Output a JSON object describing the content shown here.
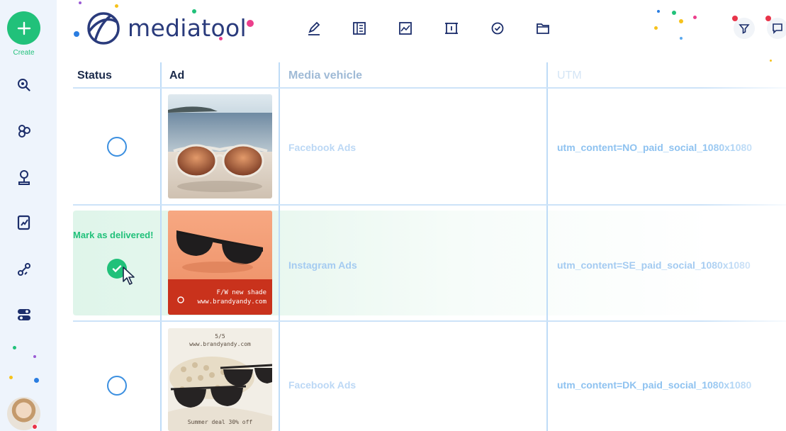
{
  "sidebar": {
    "create_label": "Create",
    "icons": [
      "search-icon",
      "hub-icon",
      "location-pin-icon",
      "report-icon",
      "link-icon",
      "toggle-icon"
    ]
  },
  "header": {
    "logo_text": "mediatool",
    "toolbar_icons": [
      "pen-icon",
      "form-icon",
      "chart-icon",
      "frame-icon",
      "check-badge-icon",
      "folder-icon"
    ],
    "right_buttons": [
      "filter-icon",
      "comment-icon"
    ]
  },
  "table": {
    "columns": [
      "Status",
      "Ad",
      "Media vehicle",
      "UTM"
    ],
    "rows": [
      {
        "status": "unchecked",
        "media_vehicle": "Facebook Ads",
        "utm": "utm_content=NO_paid_social_1080x1080"
      },
      {
        "status": "checked",
        "media_vehicle": "Instagram Ads",
        "utm": "utm_content=SE_paid_social_1080x1080"
      },
      {
        "status": "unchecked",
        "media_vehicle": "Facebook Ads",
        "utm": "utm_content=DK_paid_social_1080x1080"
      }
    ],
    "hover_label": "Mark as delivered!"
  },
  "ads": {
    "ad2": {
      "line1": "F/W new shade",
      "line2": "www.brandyandy.com"
    },
    "ad3": {
      "top1": "5/5",
      "top2": "www.brandyandy.com",
      "bottom": "Summer deal 30% off"
    }
  },
  "colors": {
    "brand_green": "#21c17a",
    "brand_navy": "#2a3b7c",
    "accent_blue": "#3b8fe0"
  }
}
